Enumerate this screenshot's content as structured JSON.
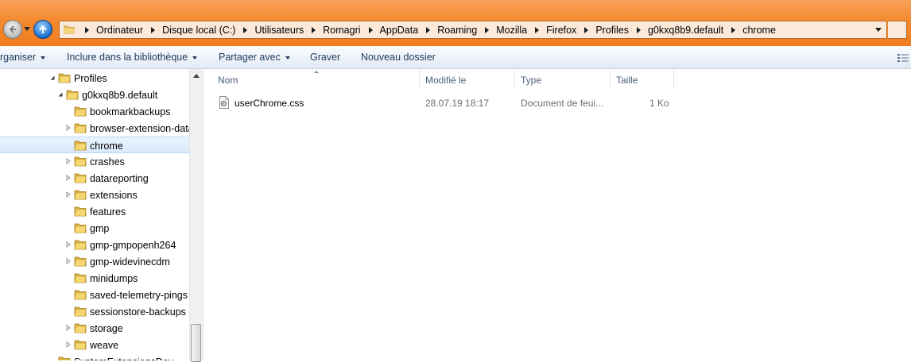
{
  "address": {
    "crumbs": [
      "Ordinateur",
      "Disque local (C:)",
      "Utilisateurs",
      "Romagri",
      "AppData",
      "Roaming",
      "Mozilla",
      "Firefox",
      "Profiles",
      "g0kxq8b9.default",
      "chrome"
    ]
  },
  "toolbar": {
    "organize": "rganiser",
    "include_library": "Inclure dans la bibliothèque",
    "share_with": "Partager avec",
    "burn": "Graver",
    "new_folder": "Nouveau dossier"
  },
  "tree": [
    {
      "label": "Profiles",
      "expander": "expanded",
      "level": 0
    },
    {
      "label": "g0kxq8b9.default",
      "expander": "expanded",
      "level": 1
    },
    {
      "label": "bookmarkbackups",
      "expander": "none",
      "level": 2
    },
    {
      "label": "browser-extension-data",
      "expander": "collapsed",
      "level": 2
    },
    {
      "label": "chrome",
      "expander": "none",
      "level": 2,
      "selected": true
    },
    {
      "label": "crashes",
      "expander": "collapsed",
      "level": 2
    },
    {
      "label": "datareporting",
      "expander": "collapsed",
      "level": 2
    },
    {
      "label": "extensions",
      "expander": "collapsed",
      "level": 2
    },
    {
      "label": "features",
      "expander": "none",
      "level": 2
    },
    {
      "label": "gmp",
      "expander": "none",
      "level": 2
    },
    {
      "label": "gmp-gmpopenh264",
      "expander": "collapsed",
      "level": 2
    },
    {
      "label": "gmp-widevinecdm",
      "expander": "collapsed",
      "level": 2
    },
    {
      "label": "minidumps",
      "expander": "none",
      "level": 2
    },
    {
      "label": "saved-telemetry-pings",
      "expander": "none",
      "level": 2
    },
    {
      "label": "sessionstore-backups",
      "expander": "none",
      "level": 2
    },
    {
      "label": "storage",
      "expander": "collapsed",
      "level": 2
    },
    {
      "label": "weave",
      "expander": "collapsed",
      "level": 2
    },
    {
      "label": "SystemExtensionsDev",
      "expander": "none",
      "level": 0,
      "partially_visible": true
    }
  ],
  "columns": {
    "name": "Nom",
    "modified": "Modifié le",
    "type": "Type",
    "size": "Taille"
  },
  "files": [
    {
      "name": "userChrome.css",
      "modified": "28.07.19 18:17",
      "type": "Document de feui...",
      "size": "1 Ko",
      "icon": "css-file-icon"
    }
  ],
  "colors": {
    "title_bar": "#f5892f",
    "address_bg": "#fce9d9",
    "selection": "#d9eafb",
    "toolbar_text": "#1e395b"
  }
}
